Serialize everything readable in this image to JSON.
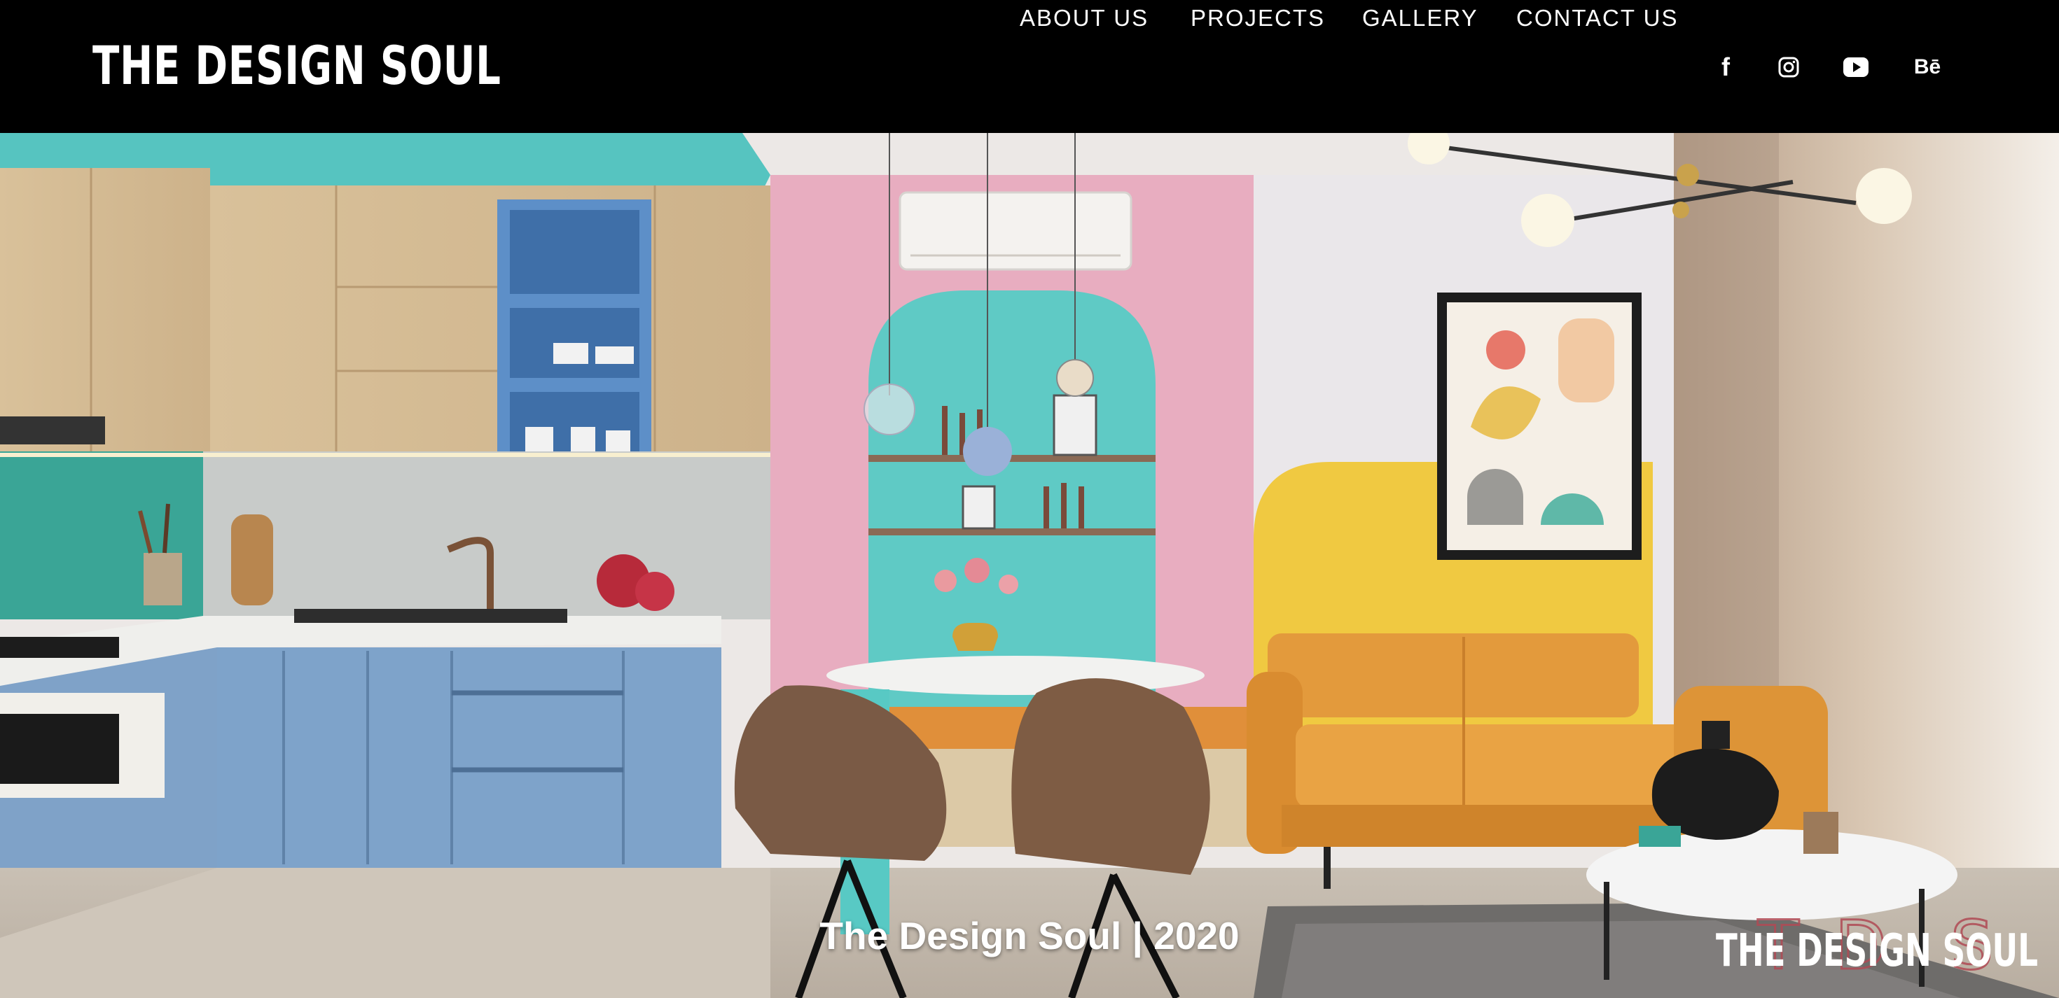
{
  "header": {
    "logo": "THE DESIGN SOUL",
    "nav": [
      {
        "label": "ABOUT US"
      },
      {
        "label": "PROJECTS"
      },
      {
        "label": "GALLERY"
      },
      {
        "label": "CONTACT US"
      }
    ],
    "social": [
      {
        "icon": "facebook-icon",
        "glyph": "f"
      },
      {
        "icon": "instagram-icon"
      },
      {
        "icon": "youtube-icon"
      },
      {
        "icon": "behance-icon",
        "glyph": "Bē"
      }
    ]
  },
  "hero": {
    "caption": "The Design Soul | 2020",
    "watermark_text": "THE DESIGN SOUL"
  },
  "colors": {
    "header_bg": "#000000",
    "teal": "#5FC9C4",
    "pink": "#E9AEC0",
    "yellow": "#F2CB4A",
    "cabinet_blue": "#7FA3C9",
    "sofa_orange": "#E39A3C"
  }
}
